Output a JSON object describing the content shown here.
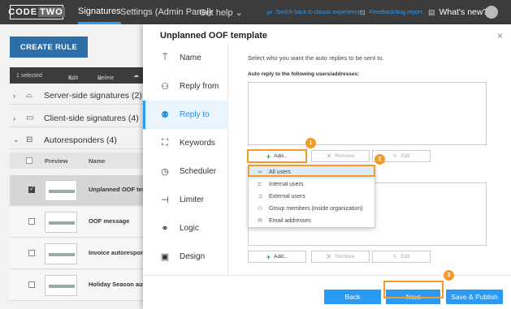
{
  "topbar": {
    "logo_left": "CODE",
    "logo_right": "TWO",
    "nav": [
      "Signatures",
      "Settings (Admin Panel)",
      "Get help ⌄"
    ],
    "switch_link": "Switch back to classic experience",
    "feedback_link": "Feedback/bug report",
    "whats_new": "What's new?"
  },
  "background": {
    "create_rule": "CREATE RULE",
    "toolbar": {
      "selected": "1 selected",
      "edit": "Edit",
      "delete": "Delete"
    },
    "groups": [
      {
        "label": "Server-side signatures (2)",
        "chevron": "›"
      },
      {
        "label": "Client-side signatures (4)",
        "chevron": "›"
      },
      {
        "label": "Autoresponders (4)",
        "chevron": "⌄"
      }
    ],
    "columns": {
      "preview": "Preview",
      "name": "Name"
    },
    "rows": [
      {
        "name": "Unplanned OOF template",
        "selected": true
      },
      {
        "name": "OOF message",
        "selected": false
      },
      {
        "name": "Invoice autoresponder",
        "selected": false
      },
      {
        "name": "Holiday Season autoresponder",
        "selected": false
      }
    ]
  },
  "modal": {
    "title": "Unplanned OOF template",
    "close": "×",
    "sidebar": [
      {
        "label": "Name",
        "icon": "signpost-icon"
      },
      {
        "label": "Reply from",
        "icon": "user-reply-icon"
      },
      {
        "label": "Reply to",
        "icon": "users-reply-icon",
        "active": true
      },
      {
        "label": "Keywords",
        "icon": "keywords-icon"
      },
      {
        "label": "Scheduler",
        "icon": "clock-icon"
      },
      {
        "label": "Limiter",
        "icon": "limiter-icon"
      },
      {
        "label": "Logic",
        "icon": "logic-icon"
      },
      {
        "label": "Design",
        "icon": "design-icon"
      }
    ],
    "instruction": "Select who you want the auto replies to be sent to.",
    "field_label": "Auto reply to the following users/addresses:",
    "buttons": {
      "add": "Add...",
      "remove": "Remove",
      "edit": "Edit"
    },
    "dropdown": [
      {
        "label": "All users",
        "selected": true
      },
      {
        "label": "Internal users"
      },
      {
        "label": "External users"
      },
      {
        "label": "Group members (inside organization)"
      },
      {
        "label": "Email addresses"
      }
    ],
    "badges": [
      "1",
      "2",
      "3"
    ],
    "footer": {
      "back": "Back",
      "next": "Next",
      "save_publish": "Save & Publish"
    }
  },
  "colors": {
    "accent": "#2b9af3",
    "highlight": "#f39a2a",
    "topbar": "#3c3c3c",
    "add_plus": "#2e9a48"
  }
}
